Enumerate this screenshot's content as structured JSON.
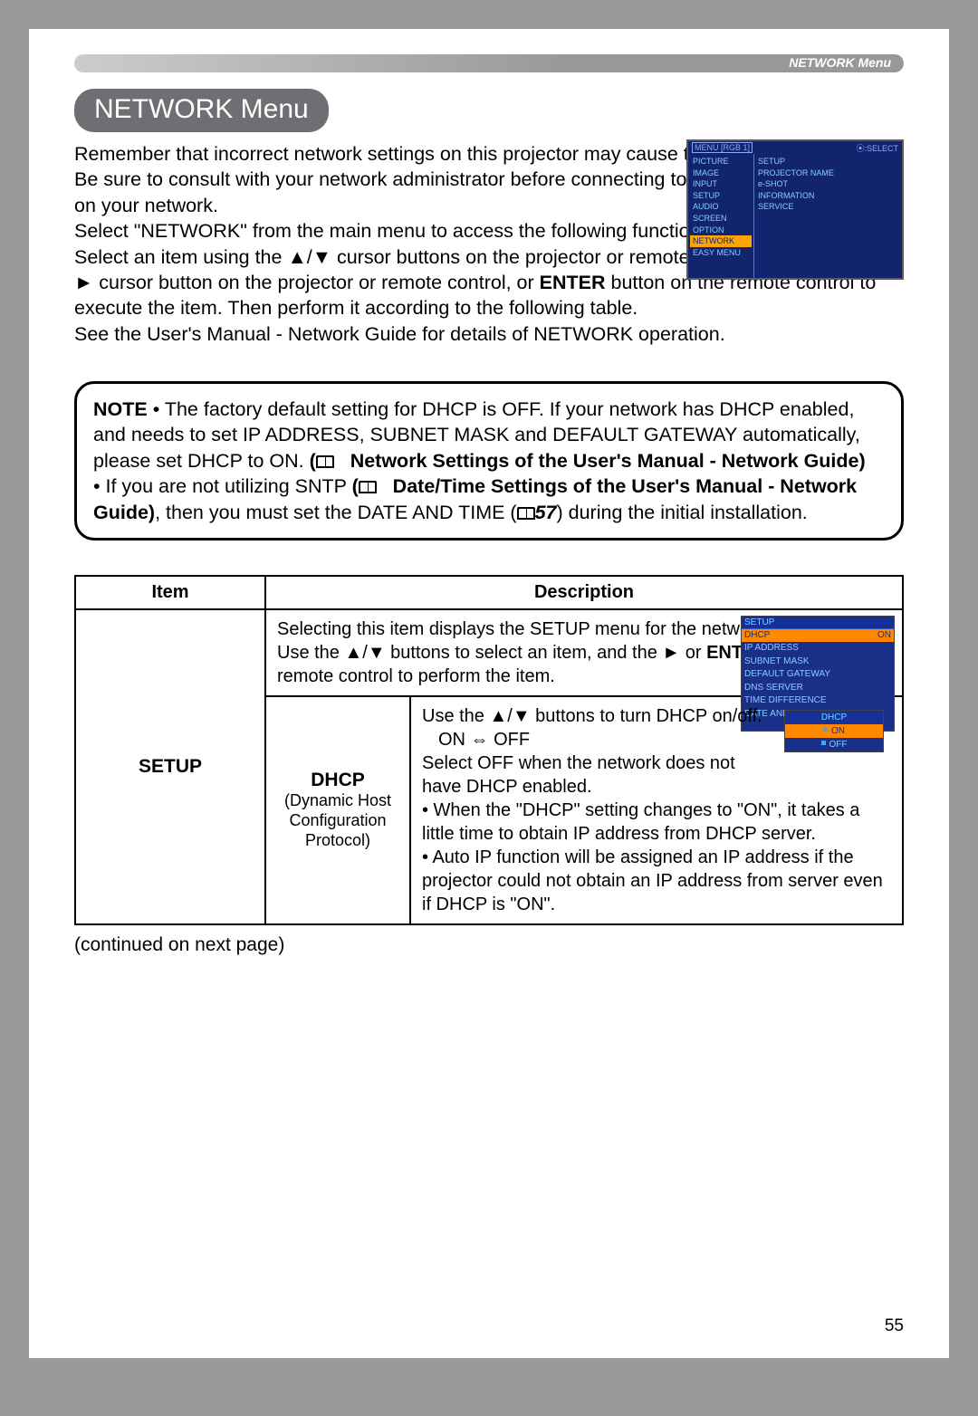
{
  "header_label": "NETWORK Menu",
  "title": "NETWORK Menu",
  "intro": {
    "p1a": "Remember that incorrect network settings on this projector may cause trouble on the network. Be sure to consult with your network administrator before connecting to an existing access point on your network.",
    "p1b": "Select \"NETWORK\" from the main menu to access the following functions.",
    "p2a": "Select an item using the ▲/▼ cursor buttons on the projector or remote control, and press the ► cursor button on the projector or remote control, or ",
    "p2b_bold": "ENTER",
    "p2c": " button on the remote control to execute the item. Then perform it according to the following table.",
    "p3": "See the User's Manual - Network Guide for details of NETWORK operation."
  },
  "menu_thumb": {
    "header_left": "MENU [RGB 1]",
    "header_right": "⦿:SELECT",
    "col1": [
      "PICTURE",
      "IMAGE",
      "INPUT",
      "SETUP",
      "AUDIO",
      "SCREEN",
      "OPTION",
      "NETWORK",
      "EASY MENU"
    ],
    "col1_highlight": "NETWORK",
    "col2": [
      "SETUP",
      "PROJECTOR NAME",
      "e-SHOT",
      "INFORMATION",
      "SERVICE"
    ]
  },
  "note": {
    "label": "NOTE",
    "n1a": " • The factory default setting for DHCP is OFF. If your network has DHCP enabled, and needs to set IP ADDRESS, SUBNET MASK and DEFAULT GATEWAY automatically, please set DHCP to ON. ",
    "n1b_bold": "Network Settings of the User's Manual - Network Guide)",
    "n2a": "• If you are not utilizing SNTP ",
    "n2b_bold": "Date/Time Settings of the User's Manual - Network Guide)",
    "n2c": ", then you must set the DATE AND TIME (",
    "n2d_bolditalic": "57",
    "n2e": ") during the initial installation."
  },
  "table": {
    "head_item": "Item",
    "head_desc": "Description",
    "row_item": "SETUP",
    "row1_desc_a": "Selecting this item displays the SETUP menu for the network.",
    "row1_desc_b": "Use the ▲/▼ buttons to select an item, and the ► or ",
    "row1_desc_b_bold": "ENTER",
    "row1_desc_c": " button on the remote control to perform the item.",
    "sub_title": "DHCP",
    "sub_note": "(Dynamic Host Configuration Protocol)",
    "row2_a": "Use the ▲/▼ buttons to turn DHCP on/off.",
    "row2_b": "ON ⇔ OFF",
    "row2_c": "Select OFF when the network does not have DHCP enabled.",
    "row2_d": "• When the \"DHCP\" setting changes to \"ON\", it takes a little time to obtain IP address from DHCP server.",
    "row2_e": "• Auto IP function will be assigned an IP address if the projector could not obtain an IP address from server even if DHCP is \"ON\"."
  },
  "mini_setup": {
    "header": "SETUP",
    "rows": [
      {
        "l": "DHCP",
        "r": "ON",
        "hl": true
      },
      {
        "l": "IP ADDRESS",
        "r": ""
      },
      {
        "l": "SUBNET MASK",
        "r": ""
      },
      {
        "l": "DEFAULT GATEWAY",
        "r": ""
      },
      {
        "l": "DNS SERVER",
        "r": ""
      },
      {
        "l": "TIME DIFFERENCE",
        "r": ""
      },
      {
        "l": "DATE AND TIME",
        "r": ""
      }
    ]
  },
  "mini_dhcp": {
    "header": "DHCP",
    "on": "ON",
    "off": "OFF"
  },
  "continued": "(continued on next page)",
  "page_number": "55"
}
